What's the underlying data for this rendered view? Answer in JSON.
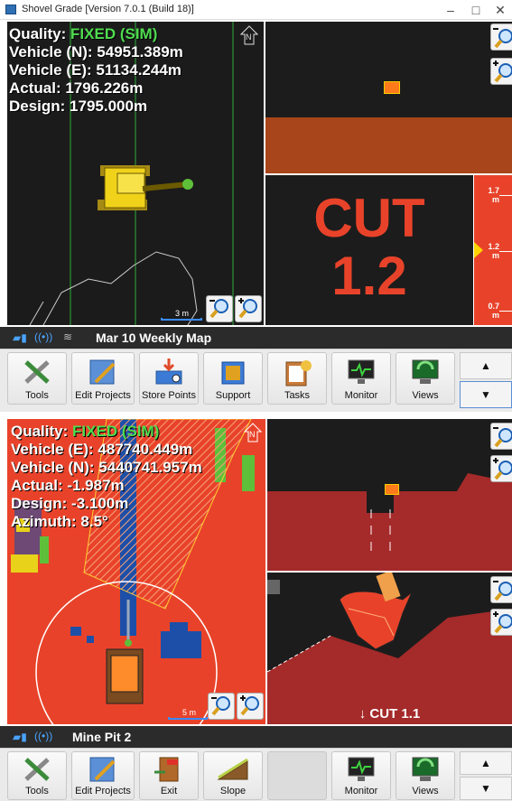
{
  "window": {
    "title": "Shovel Grade [Version 7.0.1 (Build 18)]",
    "minimize": "–",
    "maximize": "□",
    "close": "✕"
  },
  "top": {
    "quality_label": "Quality:",
    "quality_value": "FIXED (SIM)",
    "line1": "Vehicle (N): 54951.389m",
    "line2": "Vehicle (E): 51134.244m",
    "line3": "Actual: 1796.226m",
    "line4": "Design: 1795.000m",
    "scale": "3 m",
    "cut_word": "CUT",
    "cut_value": "1.2",
    "gauge": {
      "top": "1.7",
      "mid": "1.2",
      "bottom": "0.7",
      "unit": "m"
    },
    "status_title": "Mar 10 Weekly Map",
    "toolbar": [
      "Tools",
      "Edit Projects",
      "Store Points",
      "Support",
      "Tasks",
      "Monitor",
      "Views"
    ],
    "north": "N"
  },
  "bottom": {
    "quality_label": "Quality:",
    "quality_value": "FIXED (SIM)",
    "line1": "Vehicle (E): 487740.449m",
    "line2": "Vehicle (N): 5440741.957m",
    "line3": "Actual: -1.987m",
    "line4": "Design: -3.100m",
    "line5": "Azimuth: 8.5°",
    "scale": "5 m",
    "cut_text": "↓ CUT 1.1",
    "status_title": "Mine Pit 2",
    "toolbar": [
      "Tools",
      "Edit Projects",
      "Exit",
      "Slope",
      "",
      "Monitor",
      "Views"
    ],
    "north": "N"
  },
  "nav": {
    "up": "▲",
    "down": "▼"
  },
  "colors": {
    "cut_red": "#e8432a",
    "fixed_green": "#4fdc4f",
    "ground": "#a8451a",
    "profile": "#a52a2a"
  }
}
